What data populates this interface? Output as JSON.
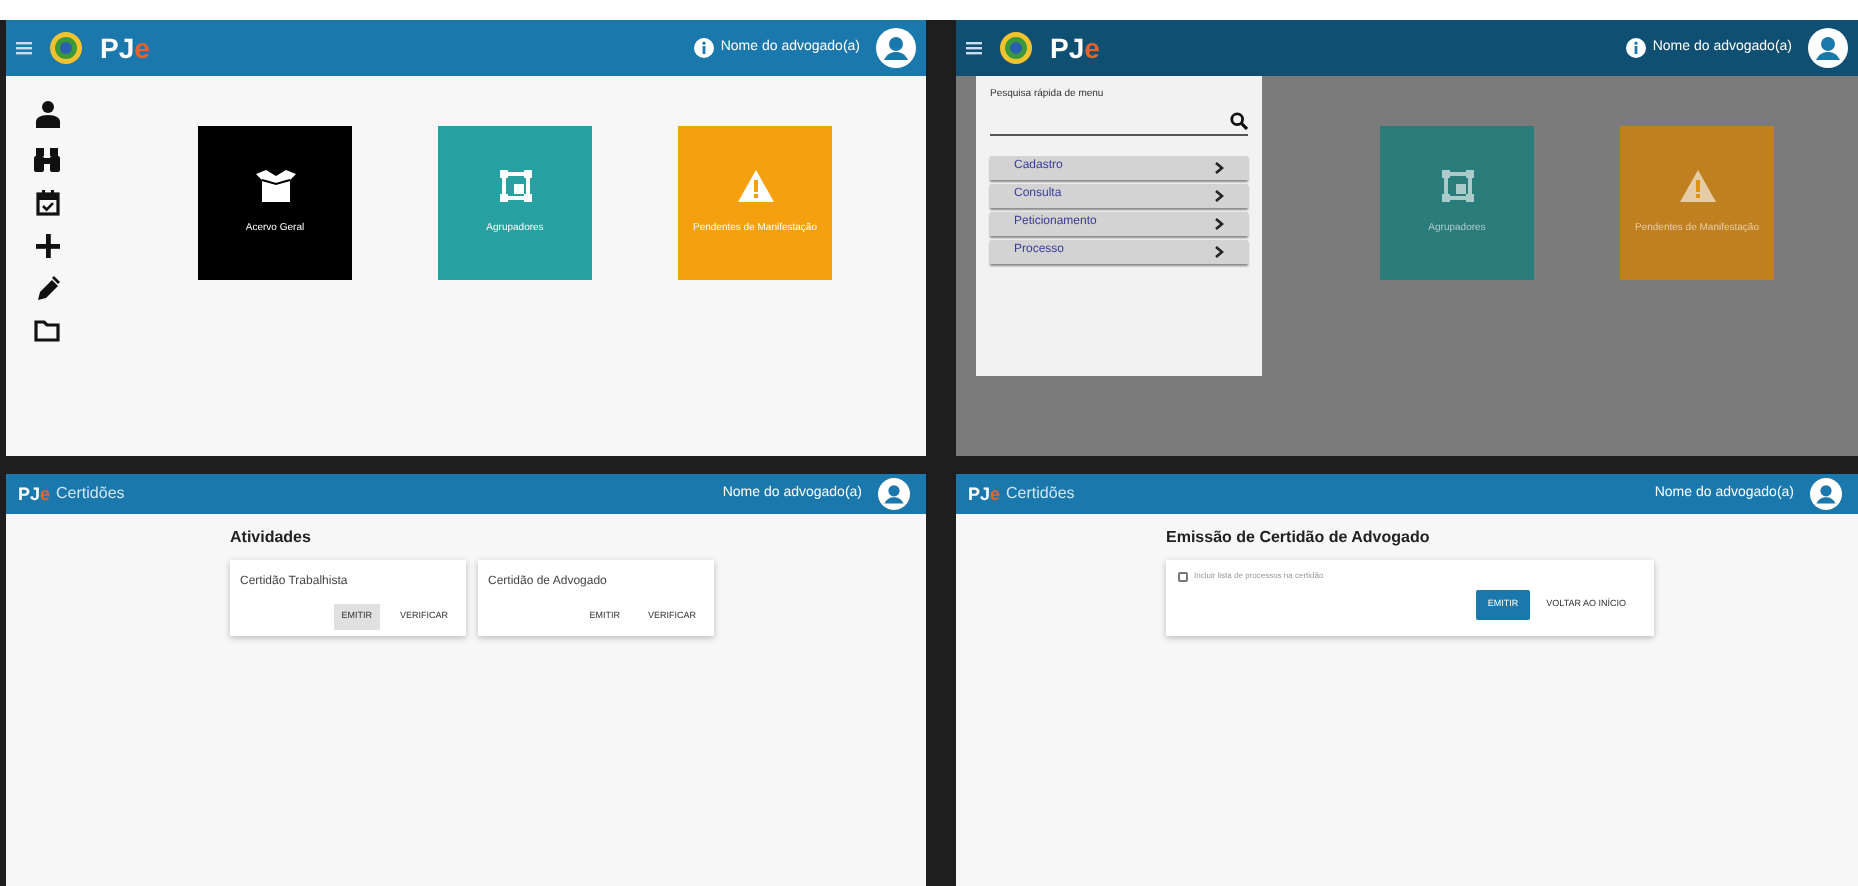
{
  "panels": [
    {
      "kind": "home",
      "header": {
        "logo": "PJe",
        "user": "Nome do advogado(a)"
      },
      "tiles": [
        {
          "label": "Acervo Geral",
          "color": "#000000",
          "kind": "box"
        },
        {
          "label": "Agrupadores",
          "color": "#26a0a0",
          "kind": "frame"
        },
        {
          "label": "Pendentes de Manifestação",
          "color": "#f5a00f",
          "kind": "warning"
        }
      ]
    },
    {
      "kind": "home_menu",
      "header": {
        "logo": "PJe",
        "user": "Nome do advogado(a)"
      },
      "menu": {
        "search_label": "Pesquisa rápida de menu",
        "items": [
          {
            "label": "Cadastro"
          },
          {
            "label": "Consulta"
          },
          {
            "label": "Peticionamento"
          },
          {
            "label": "Processo"
          }
        ]
      },
      "tiles": [
        {
          "label": "Agrupadores",
          "color": "#2a7d7a",
          "kind": "frame"
        },
        {
          "label": "Pendentes de Manifestação",
          "color": "#c08020",
          "kind": "warning"
        }
      ]
    },
    {
      "kind": "certidoes",
      "header": {
        "logo": "PJe",
        "app": "Certidões",
        "user": "Nome do advogado(a)"
      },
      "title": "Atividades",
      "cards": [
        {
          "title": "Certidão Trabalhista",
          "buttons": [
            {
              "label": "EMITIR",
              "selected": true
            },
            {
              "label": "VERIFICAR",
              "selected": false
            }
          ]
        },
        {
          "title": "Certidão de Advogado",
          "buttons": [
            {
              "label": "EMITIR",
              "selected": false
            },
            {
              "label": "VERIFICAR",
              "selected": false
            }
          ]
        }
      ]
    },
    {
      "kind": "emissao",
      "header": {
        "logo": "PJe",
        "app": "Certidões",
        "user": "Nome do advogado(a)"
      },
      "title": "Emissão de Certidão de Advogado",
      "checkbox": {
        "label": "Incluir lista de processos na certidão",
        "checked": false
      },
      "buttons": [
        {
          "label": "EMITIR",
          "kind": "primary"
        },
        {
          "label": "VOLTAR AO INÍCIO",
          "kind": "text"
        }
      ]
    }
  ]
}
